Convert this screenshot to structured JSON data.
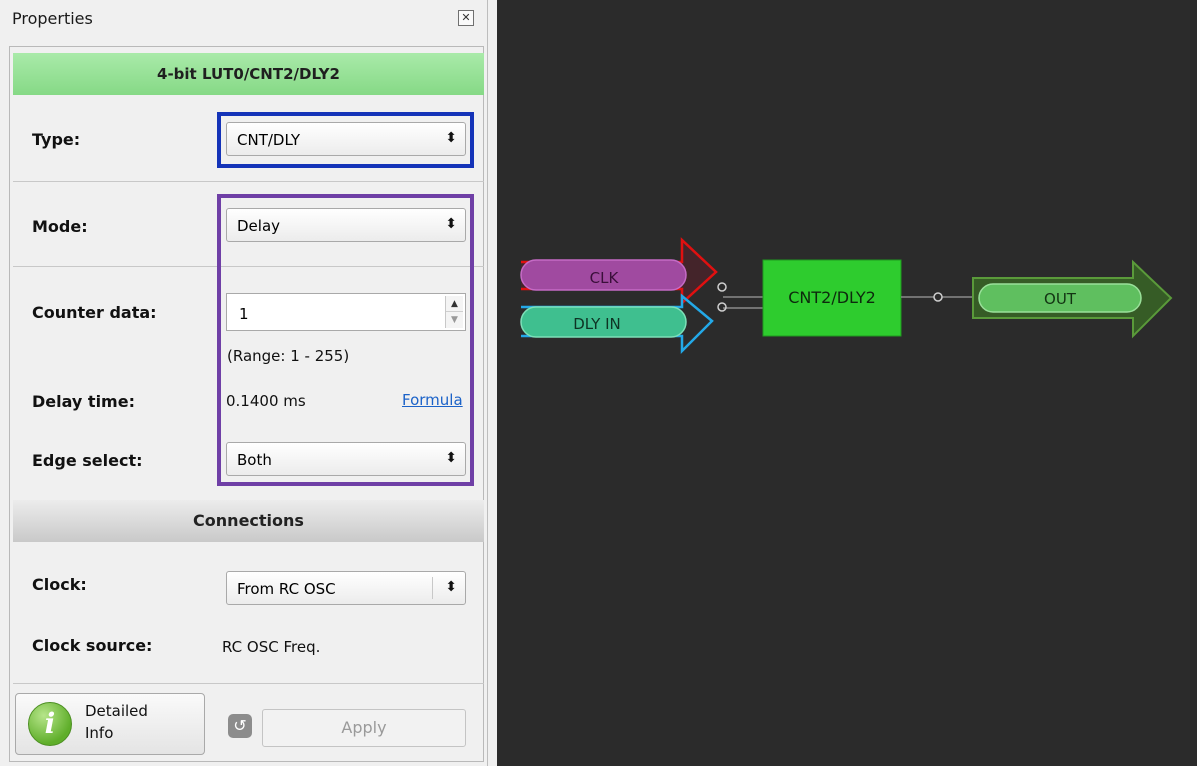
{
  "window": {
    "title": "Properties"
  },
  "component": {
    "header": "4-bit LUT0/CNT2/DLY2"
  },
  "fields": {
    "type": {
      "label": "Type:",
      "value": "CNT/DLY"
    },
    "mode": {
      "label": "Mode:",
      "value": "Delay"
    },
    "counter_data": {
      "label": "Counter data:",
      "value": "1",
      "range": "(Range:  1 - 255)"
    },
    "delay_time": {
      "label": "Delay time:",
      "value": "0.1400 ms",
      "link": "Formula"
    },
    "edge_select": {
      "label": "Edge select:",
      "value": "Both"
    }
  },
  "connections": {
    "header": "Connections",
    "clock": {
      "label": "Clock:",
      "value": "From RC OSC"
    },
    "clock_source": {
      "label": "Clock source:",
      "value": "RC OSC Freq."
    }
  },
  "buttons": {
    "detailed_line1": "Detailed",
    "detailed_line2": "Info",
    "apply": "Apply"
  },
  "schematic": {
    "inputs": [
      {
        "label": "CLK"
      },
      {
        "label": "DLY IN"
      }
    ],
    "block": "CNT2/DLY2",
    "output": "OUT"
  },
  "colors": {
    "header_green": "#86d986",
    "highlight_blue": "#1433b8",
    "highlight_purple": "#6f3fa6",
    "canvas_bg": "#2b2b2b",
    "block_green": "#2ecc2e",
    "clk_pill": "#a04aa0",
    "dly_pill": "#3fbf8f",
    "out_pill": "#5fbf5f",
    "clk_arrow": "#e01010",
    "dly_arrow": "#23a9e8"
  },
  "icons": {
    "close": "close-icon",
    "combo": "updown-arrows-icon",
    "info": "info-icon",
    "undo": "undo-icon"
  }
}
